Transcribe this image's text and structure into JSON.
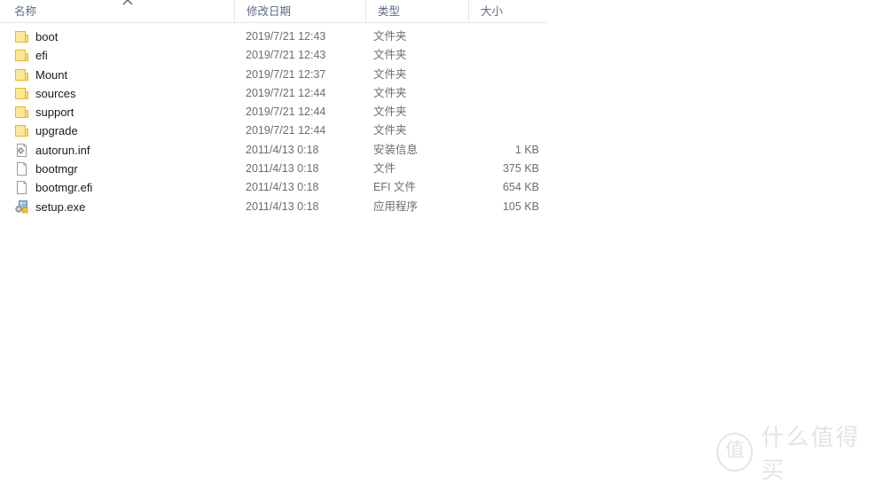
{
  "window": {
    "background_color": "#ffffff"
  },
  "columns": {
    "header_text_color": "#5d6b86",
    "sort_indicator_icon": "chevron-up-icon",
    "items": [
      {
        "key": "name",
        "label": "名称"
      },
      {
        "key": "date",
        "label": "修改日期"
      },
      {
        "key": "type",
        "label": "类型"
      },
      {
        "key": "size",
        "label": "大小"
      }
    ]
  },
  "files": [
    {
      "name": "boot",
      "date": "2019/7/21 12:43",
      "type": "文件夹",
      "size": "",
      "icon": "folder-icon"
    },
    {
      "name": "efi",
      "date": "2019/7/21 12:43",
      "type": "文件夹",
      "size": "",
      "icon": "folder-icon"
    },
    {
      "name": "Mount",
      "date": "2019/7/21 12:37",
      "type": "文件夹",
      "size": "",
      "icon": "folder-icon"
    },
    {
      "name": "sources",
      "date": "2019/7/21 12:44",
      "type": "文件夹",
      "size": "",
      "icon": "folder-icon"
    },
    {
      "name": "support",
      "date": "2019/7/21 12:44",
      "type": "文件夹",
      "size": "",
      "icon": "folder-icon"
    },
    {
      "name": "upgrade",
      "date": "2019/7/21 12:44",
      "type": "文件夹",
      "size": "",
      "icon": "folder-icon"
    },
    {
      "name": "autorun.inf",
      "date": "2011/4/13 0:18",
      "type": "安装信息",
      "size": "1 KB",
      "icon": "setup-information-file-icon"
    },
    {
      "name": "bootmgr",
      "date": "2011/4/13 0:18",
      "type": "文件",
      "size": "375 KB",
      "icon": "blank-document-icon"
    },
    {
      "name": "bootmgr.efi",
      "date": "2011/4/13 0:18",
      "type": "EFI 文件",
      "size": "654 KB",
      "icon": "blank-document-icon"
    },
    {
      "name": "setup.exe",
      "date": "2011/4/13 0:18",
      "type": "应用程序",
      "size": "105 KB",
      "icon": "application-executable-icon"
    }
  ],
  "watermark": {
    "logo_glyph": "值",
    "text": "什么值得买",
    "color": "#e3e4e6"
  }
}
